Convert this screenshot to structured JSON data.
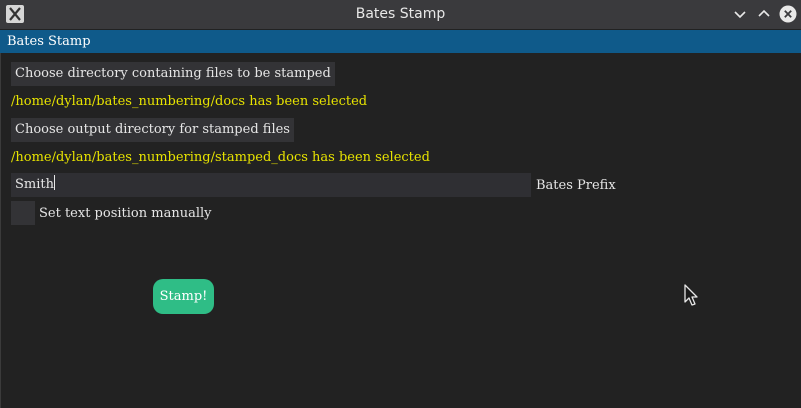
{
  "window": {
    "title": "Bates Stamp",
    "icon": "x-app-icon"
  },
  "menu": {
    "label": "Bates Stamp"
  },
  "form": {
    "choose_input_label": "Choose directory containing files to be stamped",
    "input_status": "/home/dylan/bates_numbering/docs has been selected",
    "choose_output_label": "Choose output directory for stamped files",
    "output_status": "/home/dylan/bates_numbering/stamped_docs has been selected",
    "prefix_value": "Smith",
    "prefix_label": "Bates Prefix",
    "manual_position_label": "Set text position manually",
    "manual_position_checked": false,
    "stamp_label": "Stamp!"
  },
  "colors": {
    "titlebar": "#3a3a3d",
    "menubar": "#0f5a8a",
    "background": "#222222",
    "status_text": "#e7e300",
    "stamp_button": "#2fbd86"
  }
}
